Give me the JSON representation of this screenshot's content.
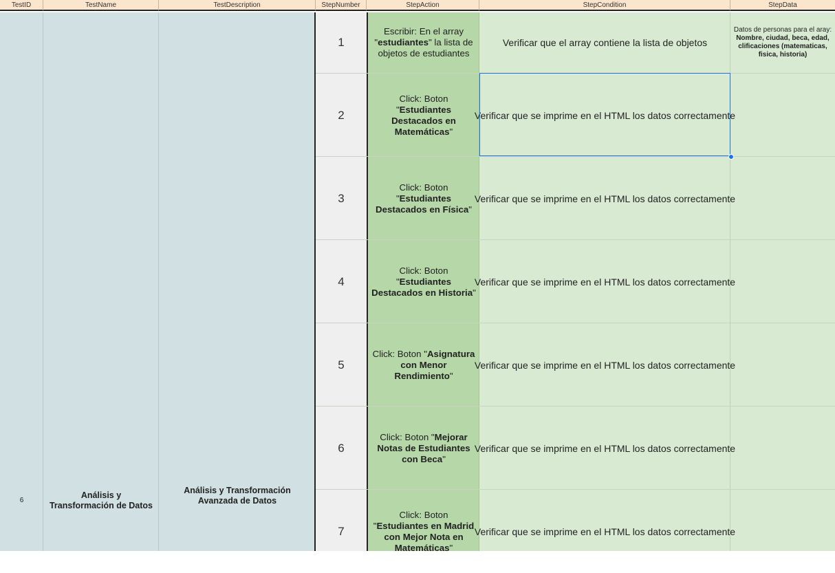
{
  "headers": [
    "TestID",
    "TestName",
    "TestDescription",
    "StepNumber",
    "StepAction",
    "StepCondition",
    "StepData"
  ],
  "test": {
    "id": "6",
    "name": "Análisis y Transformación de Datos",
    "description": "Análisis y Transformación Avanzada de Datos"
  },
  "steps": [
    {
      "number": "1",
      "action_pre": "Escribir: En el array \"",
      "action_bold": "estudiantes",
      "action_post": "\" la lista de objetos de estudiantes",
      "condition": "Verificar que el array contiene la lista de objetos",
      "data_pre": "Datos de personas para el aray: ",
      "data_bold": "Nombre, ciudad, beca, edad, clificaciones (matematicas, fisica, historia)"
    },
    {
      "number": "2",
      "action_pre": "Click: Boton \"",
      "action_bold": "Estudiantes Destacados en Matemáticas",
      "action_post": "\"",
      "condition": "Verificar que se imprime en el HTML los datos correctamente",
      "data_pre": "",
      "data_bold": ""
    },
    {
      "number": "3",
      "action_pre": "Click: Boton \"",
      "action_bold": "Estudiantes Destacados en Física",
      "action_post": "\"",
      "condition": "Verificar que se imprime en el HTML los datos correctamente",
      "data_pre": "",
      "data_bold": ""
    },
    {
      "number": "4",
      "action_pre": "Click: Boton \"",
      "action_bold": "Estudiantes Destacados en Historia",
      "action_post": "\"",
      "condition": "Verificar que se imprime en el HTML los datos correctamente",
      "data_pre": "",
      "data_bold": ""
    },
    {
      "number": "5",
      "action_pre": "Click: Boton \"",
      "action_bold": "Asignatura con Menor Rendimiento",
      "action_post": "\"",
      "condition": "Verificar que se imprime en el HTML los datos correctamente",
      "data_pre": "",
      "data_bold": ""
    },
    {
      "number": "6",
      "action_pre": "Click: Boton \"",
      "action_bold": "Mejorar Notas de Estudiantes con Beca",
      "action_post": "\"",
      "condition": "Verificar que se imprime en el HTML los datos correctamente",
      "data_pre": "",
      "data_bold": ""
    },
    {
      "number": "7",
      "action_pre": "Click: Boton \"",
      "action_bold": "Estudiantes en Madrid con Mejor Nota en Matemáticas",
      "action_post": "\"",
      "condition": "Verificar que se imprime en el HTML los datos correctamente",
      "data_pre": "",
      "data_bold": ""
    }
  ],
  "colors": {
    "header_bg": "#fce5cd",
    "blue_col": "#d0e0e3",
    "step_col": "#efefef",
    "action_col": "#b6d7a8",
    "cond_col": "#d9ead3",
    "selection": "#1a73e8"
  }
}
